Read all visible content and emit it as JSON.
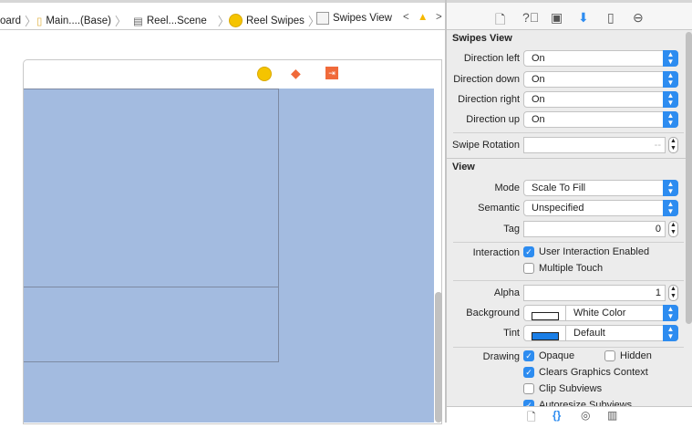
{
  "breadcrumb": {
    "items": [
      "oard",
      "Main....(Base)",
      "Reel...Scene",
      "Reel Swipes",
      "Swipes View"
    ]
  },
  "inspector": {
    "tabs": [
      "file-icon",
      "help-icon",
      "identity-icon",
      "attributes-icon",
      "size-icon",
      "connections-icon"
    ],
    "active_tab": "attributes-icon",
    "swipes_view": {
      "title": "Swipes View",
      "rows": [
        {
          "label": "Direction left",
          "value": "On"
        },
        {
          "label": "Direction down",
          "value": "On"
        },
        {
          "label": "Direction right",
          "value": "On"
        },
        {
          "label": "Direction up",
          "value": "On"
        }
      ],
      "swipe_rotation": {
        "label": "Swipe Rotation",
        "value": "--"
      }
    },
    "view": {
      "title": "View",
      "mode": {
        "label": "Mode",
        "value": "Scale To Fill"
      },
      "semantic": {
        "label": "Semantic",
        "value": "Unspecified"
      },
      "tag": {
        "label": "Tag",
        "value": "0"
      },
      "interaction": {
        "label": "Interaction",
        "user_interaction": "User Interaction Enabled",
        "user_interaction_checked": true,
        "multiple_touch": "Multiple Touch",
        "multiple_touch_checked": false
      },
      "alpha": {
        "label": "Alpha",
        "value": "1"
      },
      "background": {
        "label": "Background",
        "value": "White Color",
        "swatch": "#ffffff"
      },
      "tint": {
        "label": "Tint",
        "value": "Default",
        "swatch": "#1a7ee6"
      },
      "drawing": {
        "label": "Drawing",
        "opaque": "Opaque",
        "opaque_checked": true,
        "hidden": "Hidden",
        "hidden_checked": false,
        "clears": "Clears Graphics Context",
        "clears_checked": true,
        "clip": "Clip Subviews",
        "clip_checked": false,
        "autoresize": "Autoresize Subviews",
        "autoresize_checked": true
      }
    }
  },
  "colors": {
    "accent": "#2d8cf0",
    "canvas_view": "#a3bbe0",
    "scene_icon": "#f5c400",
    "first_responder": "#f06a3a"
  }
}
